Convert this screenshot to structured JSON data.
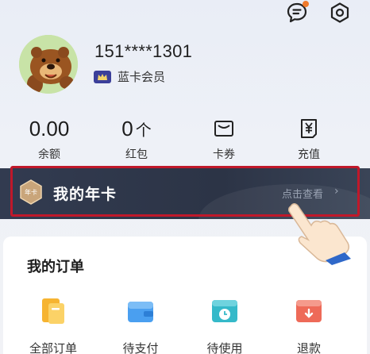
{
  "header": {
    "message_icon": "chat-bubble-icon",
    "settings_icon": "hexagon-gear-icon",
    "notification_dot_color": "#f07a2b"
  },
  "profile": {
    "phone": "151****1301",
    "membership": "蓝卡会员",
    "membership_badge_color": "#3b3f9a"
  },
  "stats": [
    {
      "value": "0.00",
      "label": "余额"
    },
    {
      "value": "0",
      "unit": "个",
      "label": "红包"
    },
    {
      "icon": "ticket-icon",
      "label": "卡券"
    },
    {
      "icon": "yuan-recharge-icon",
      "label": "充值"
    }
  ],
  "annual_card": {
    "icon_text": "年卡",
    "title": "我的年卡",
    "link": "点击查看",
    "arrow": "›",
    "highlight_color": "#c0182a"
  },
  "orders": {
    "title": "我的订单",
    "items": [
      {
        "label": "全部订单",
        "icon": "all-orders-icon",
        "color": "#f6b431"
      },
      {
        "label": "待支付",
        "icon": "wallet-icon",
        "color": "#4a9ff0"
      },
      {
        "label": "待使用",
        "icon": "clock-icon",
        "color": "#35b9c9"
      },
      {
        "label": "退款",
        "icon": "refund-icon",
        "color": "#ee6a58"
      }
    ]
  }
}
